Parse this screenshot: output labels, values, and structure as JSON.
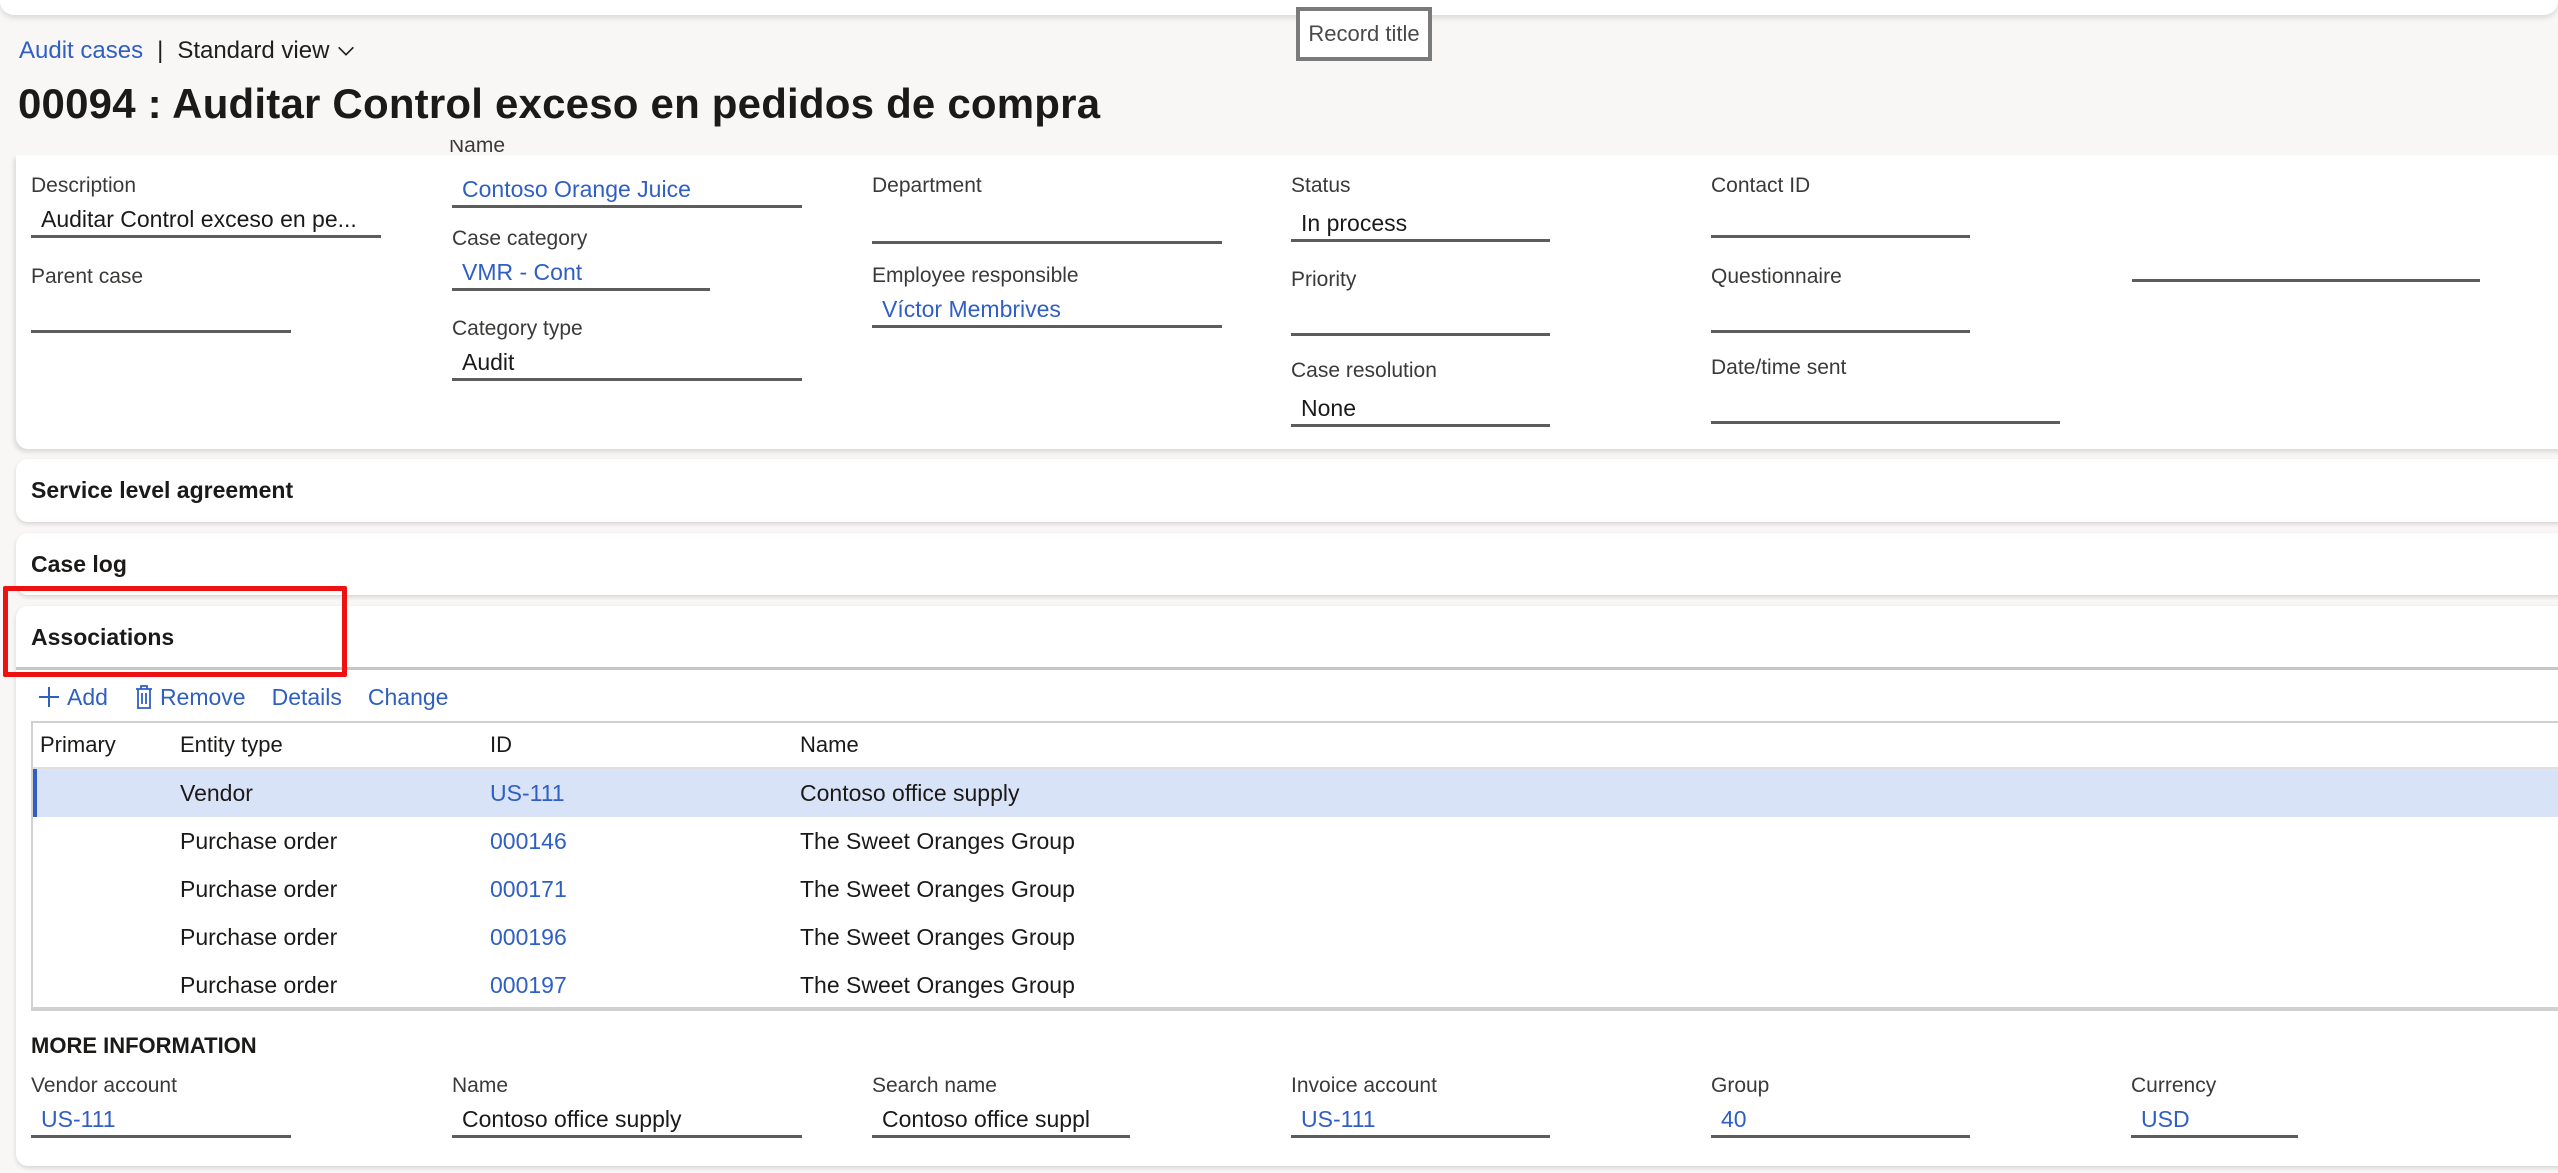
{
  "tooltip": {
    "record_title": "Record title"
  },
  "breadcrumb": {
    "link": "Audit cases",
    "separator": "|",
    "view": "Standard view"
  },
  "page_title": "00094 : Auditar Control exceso en pedidos de compra",
  "general": {
    "cut_label": "Name",
    "fields": {
      "description": {
        "label": "Description",
        "value": "Auditar Control exceso en pe..."
      },
      "parent_case": {
        "label": "Parent case",
        "value": ""
      },
      "name": {
        "label": "Name",
        "value": "Contoso Orange Juice"
      },
      "case_category": {
        "label": "Case category",
        "value": "VMR - Cont"
      },
      "category_type": {
        "label": "Category type",
        "value": "Audit"
      },
      "department": {
        "label": "Department",
        "value": ""
      },
      "employee_responsible": {
        "label": "Employee responsible",
        "value": "Víctor Membrives"
      },
      "status": {
        "label": "Status",
        "value": "In process"
      },
      "priority": {
        "label": "Priority",
        "value": ""
      },
      "case_resolution": {
        "label": "Case resolution",
        "value": "None"
      },
      "contact_id": {
        "label": "Contact ID",
        "value": ""
      },
      "questionnaire": {
        "label": "Questionnaire",
        "value": ""
      },
      "date_time_sent": {
        "label": "Date/time sent",
        "value": ""
      }
    }
  },
  "sections": {
    "sla": "Service level agreement",
    "case_log": "Case log",
    "associations": "Associations"
  },
  "toolbar": {
    "add": "Add",
    "remove": "Remove",
    "details": "Details",
    "change": "Change"
  },
  "grid": {
    "columns": [
      "Primary",
      "Entity type",
      "ID",
      "Name"
    ],
    "rows": [
      {
        "primary": "",
        "entity_type": "Vendor",
        "id": "US-111",
        "name": "Contoso office supply",
        "selected": true
      },
      {
        "primary": "",
        "entity_type": "Purchase order",
        "id": "000146",
        "name": "The Sweet Oranges Group"
      },
      {
        "primary": "",
        "entity_type": "Purchase order",
        "id": "000171",
        "name": "The Sweet Oranges Group"
      },
      {
        "primary": "",
        "entity_type": "Purchase order",
        "id": "000196",
        "name": "The Sweet Oranges Group"
      },
      {
        "primary": "",
        "entity_type": "Purchase order",
        "id": "000197",
        "name": "The Sweet Oranges Group"
      }
    ]
  },
  "more_info": {
    "title": "MORE INFORMATION",
    "fields": {
      "vendor_account": {
        "label": "Vendor account",
        "value": "US-111"
      },
      "name": {
        "label": "Name",
        "value": "Contoso office supply"
      },
      "search_name": {
        "label": "Search name",
        "value": "Contoso office suppl"
      },
      "invoice_account": {
        "label": "Invoice account",
        "value": "US-111"
      },
      "group": {
        "label": "Group",
        "value": "40"
      },
      "currency": {
        "label": "Currency",
        "value": "USD"
      }
    }
  },
  "colors": {
    "link": "#2f5fc4",
    "selected_row": "#d9e3f8",
    "highlight_box": "#ee1111"
  }
}
